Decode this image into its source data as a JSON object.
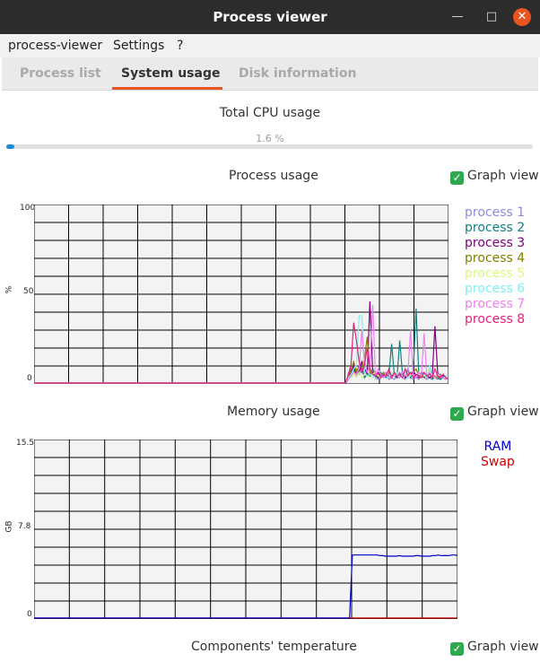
{
  "window": {
    "title": "Process viewer"
  },
  "menu": [
    "process-viewer",
    "Settings",
    "?"
  ],
  "tabs": [
    "Process list",
    "System usage",
    "Disk information"
  ],
  "cpu": {
    "title": "Total CPU usage",
    "percent_text": "1.6 %",
    "percent": 1.6
  },
  "process_usage": {
    "title": "Process usage",
    "graph_view_label": "Graph view",
    "graph_view_checked": true,
    "y_axis": {
      "label": "%",
      "ticks": [
        "100",
        "50",
        "0"
      ],
      "max": 100
    },
    "legend": [
      {
        "name": "process 1",
        "color": "#8c8cdc"
      },
      {
        "name": "process 2",
        "color": "#128080"
      },
      {
        "name": "process 3",
        "color": "#800080"
      },
      {
        "name": "process 4",
        "color": "#808000"
      },
      {
        "name": "process 5",
        "color": "#d8f880"
      },
      {
        "name": "process 6",
        "color": "#80f0f0"
      },
      {
        "name": "process 7",
        "color": "#f080f0"
      },
      {
        "name": "process 8",
        "color": "#e0207e"
      }
    ],
    "series": [
      [
        0,
        0,
        0,
        0,
        0,
        0,
        0,
        0,
        0,
        0,
        0,
        0,
        0,
        0,
        0,
        0,
        0,
        0,
        0,
        0,
        0,
        0,
        0,
        0,
        0,
        0,
        0,
        0,
        0,
        0,
        0,
        0,
        0,
        0,
        0,
        0,
        0,
        0,
        0,
        0,
        0,
        0,
        0,
        0,
        0,
        0,
        0,
        0,
        0,
        0,
        0,
        0,
        0,
        0,
        0,
        0,
        0,
        0,
        0,
        0,
        0,
        0,
        0,
        0,
        0,
        0,
        0,
        0,
        0,
        0,
        0,
        0,
        0,
        0,
        0,
        0,
        0,
        0,
        0,
        0,
        0,
        0,
        0,
        0,
        0,
        0,
        0,
        0,
        0,
        0,
        0,
        0,
        0,
        0,
        0,
        0,
        0,
        0,
        0,
        0,
        0,
        0,
        0,
        0,
        0,
        0,
        0,
        0,
        0,
        0,
        0,
        0,
        0,
        0,
        0,
        0,
        2,
        4,
        6,
        8,
        5,
        7,
        3,
        6,
        4,
        5,
        3,
        2,
        4,
        3,
        5,
        2,
        3,
        2,
        4,
        6,
        3,
        2,
        4,
        3,
        2,
        3,
        2,
        4,
        3,
        2,
        3,
        5,
        3,
        2,
        4,
        3,
        2,
        3
      ],
      [
        0,
        0,
        0,
        0,
        0,
        0,
        0,
        0,
        0,
        0,
        0,
        0,
        0,
        0,
        0,
        0,
        0,
        0,
        0,
        0,
        0,
        0,
        0,
        0,
        0,
        0,
        0,
        0,
        0,
        0,
        0,
        0,
        0,
        0,
        0,
        0,
        0,
        0,
        0,
        0,
        0,
        0,
        0,
        0,
        0,
        0,
        0,
        0,
        0,
        0,
        0,
        0,
        0,
        0,
        0,
        0,
        0,
        0,
        0,
        0,
        0,
        0,
        0,
        0,
        0,
        0,
        0,
        0,
        0,
        0,
        0,
        0,
        0,
        0,
        0,
        0,
        0,
        0,
        0,
        0,
        0,
        0,
        0,
        0,
        0,
        0,
        0,
        0,
        0,
        0,
        0,
        0,
        0,
        0,
        0,
        0,
        0,
        0,
        0,
        0,
        0,
        0,
        0,
        0,
        0,
        0,
        0,
        0,
        0,
        0,
        0,
        0,
        0,
        0,
        0,
        0,
        2,
        5,
        8,
        4,
        6,
        10,
        3,
        5,
        4,
        8,
        5,
        3,
        6,
        4,
        3,
        5,
        22,
        4,
        3,
        24,
        5,
        4,
        8,
        3,
        6,
        42,
        6,
        4,
        3,
        5,
        3,
        2,
        4,
        3,
        2,
        3,
        4,
        2
      ],
      [
        0,
        0,
        0,
        0,
        0,
        0,
        0,
        0,
        0,
        0,
        0,
        0,
        0,
        0,
        0,
        0,
        0,
        0,
        0,
        0,
        0,
        0,
        0,
        0,
        0,
        0,
        0,
        0,
        0,
        0,
        0,
        0,
        0,
        0,
        0,
        0,
        0,
        0,
        0,
        0,
        0,
        0,
        0,
        0,
        0,
        0,
        0,
        0,
        0,
        0,
        0,
        0,
        0,
        0,
        0,
        0,
        0,
        0,
        0,
        0,
        0,
        0,
        0,
        0,
        0,
        0,
        0,
        0,
        0,
        0,
        0,
        0,
        0,
        0,
        0,
        0,
        0,
        0,
        0,
        0,
        0,
        0,
        0,
        0,
        0,
        0,
        0,
        0,
        0,
        0,
        0,
        0,
        0,
        0,
        0,
        0,
        0,
        0,
        0,
        0,
        0,
        0,
        0,
        0,
        0,
        0,
        0,
        0,
        0,
        0,
        0,
        0,
        0,
        0,
        0,
        0,
        3,
        6,
        10,
        4,
        7,
        12,
        8,
        5,
        46,
        6,
        4,
        3,
        5,
        4,
        6,
        3,
        4,
        5,
        3,
        4,
        6,
        3,
        5,
        4,
        7,
        4,
        3,
        6,
        5,
        4,
        3,
        4,
        32,
        6,
        3,
        4,
        3,
        2
      ],
      [
        0,
        0,
        0,
        0,
        0,
        0,
        0,
        0,
        0,
        0,
        0,
        0,
        0,
        0,
        0,
        0,
        0,
        0,
        0,
        0,
        0,
        0,
        0,
        0,
        0,
        0,
        0,
        0,
        0,
        0,
        0,
        0,
        0,
        0,
        0,
        0,
        0,
        0,
        0,
        0,
        0,
        0,
        0,
        0,
        0,
        0,
        0,
        0,
        0,
        0,
        0,
        0,
        0,
        0,
        0,
        0,
        0,
        0,
        0,
        0,
        0,
        0,
        0,
        0,
        0,
        0,
        0,
        0,
        0,
        0,
        0,
        0,
        0,
        0,
        0,
        0,
        0,
        0,
        0,
        0,
        0,
        0,
        0,
        0,
        0,
        0,
        0,
        0,
        0,
        0,
        0,
        0,
        0,
        0,
        0,
        0,
        0,
        0,
        0,
        0,
        0,
        0,
        0,
        0,
        0,
        0,
        0,
        0,
        0,
        0,
        0,
        0,
        0,
        0,
        0,
        0,
        4,
        8,
        12,
        6,
        10,
        8,
        14,
        26,
        5,
        7,
        4,
        5,
        3,
        6,
        4,
        3,
        5,
        4,
        6,
        3,
        4,
        5,
        3,
        4,
        6,
        8,
        4,
        5,
        3,
        4,
        6,
        3,
        4,
        3,
        5,
        3,
        2,
        4
      ],
      [
        0,
        0,
        0,
        0,
        0,
        0,
        0,
        0,
        0,
        0,
        0,
        0,
        0,
        0,
        0,
        0,
        0,
        0,
        0,
        0,
        0,
        0,
        0,
        0,
        0,
        0,
        0,
        0,
        0,
        0,
        0,
        0,
        0,
        0,
        0,
        0,
        0,
        0,
        0,
        0,
        0,
        0,
        0,
        0,
        0,
        0,
        0,
        0,
        0,
        0,
        0,
        0,
        0,
        0,
        0,
        0,
        0,
        0,
        0,
        0,
        0,
        0,
        0,
        0,
        0,
        0,
        0,
        0,
        0,
        0,
        0,
        0,
        0,
        0,
        0,
        0,
        0,
        0,
        0,
        0,
        0,
        0,
        0,
        0,
        0,
        0,
        0,
        0,
        0,
        0,
        0,
        0,
        0,
        0,
        0,
        0,
        0,
        0,
        0,
        0,
        0,
        0,
        0,
        0,
        0,
        0,
        0,
        0,
        0,
        0,
        0,
        0,
        0,
        0,
        0,
        0,
        2,
        3,
        5,
        4,
        6,
        3,
        5,
        4,
        3,
        5,
        6,
        4,
        3,
        5,
        4,
        3,
        6,
        4,
        5,
        3,
        4,
        6,
        3,
        5,
        4,
        3,
        6,
        4,
        5,
        3,
        8,
        4,
        3,
        5,
        4,
        3,
        2,
        3
      ],
      [
        0,
        0,
        0,
        0,
        0,
        0,
        0,
        0,
        0,
        0,
        0,
        0,
        0,
        0,
        0,
        0,
        0,
        0,
        0,
        0,
        0,
        0,
        0,
        0,
        0,
        0,
        0,
        0,
        0,
        0,
        0,
        0,
        0,
        0,
        0,
        0,
        0,
        0,
        0,
        0,
        0,
        0,
        0,
        0,
        0,
        0,
        0,
        0,
        0,
        0,
        0,
        0,
        0,
        0,
        0,
        0,
        0,
        0,
        0,
        0,
        0,
        0,
        0,
        0,
        0,
        0,
        0,
        0,
        0,
        0,
        0,
        0,
        0,
        0,
        0,
        0,
        0,
        0,
        0,
        0,
        0,
        0,
        0,
        0,
        0,
        0,
        0,
        0,
        0,
        0,
        0,
        0,
        0,
        0,
        0,
        0,
        0,
        0,
        0,
        0,
        0,
        0,
        0,
        0,
        0,
        0,
        0,
        0,
        0,
        0,
        0,
        0,
        0,
        0,
        0,
        0,
        3,
        5,
        8,
        10,
        38,
        38,
        6,
        4,
        5,
        3,
        4,
        6,
        3,
        5,
        4,
        3,
        5,
        4,
        6,
        3,
        4,
        5,
        3,
        4,
        5,
        3,
        6,
        4,
        5,
        3,
        10,
        4,
        3,
        5,
        4,
        3,
        4,
        2
      ],
      [
        0,
        0,
        0,
        0,
        0,
        0,
        0,
        0,
        0,
        0,
        0,
        0,
        0,
        0,
        0,
        0,
        0,
        0,
        0,
        0,
        0,
        0,
        0,
        0,
        0,
        0,
        0,
        0,
        0,
        0,
        0,
        0,
        0,
        0,
        0,
        0,
        0,
        0,
        0,
        0,
        0,
        0,
        0,
        0,
        0,
        0,
        0,
        0,
        0,
        0,
        0,
        0,
        0,
        0,
        0,
        0,
        0,
        0,
        0,
        0,
        0,
        0,
        0,
        0,
        0,
        0,
        0,
        0,
        0,
        0,
        0,
        0,
        0,
        0,
        0,
        0,
        0,
        0,
        0,
        0,
        0,
        0,
        0,
        0,
        0,
        0,
        0,
        0,
        0,
        0,
        0,
        0,
        0,
        0,
        0,
        0,
        0,
        0,
        0,
        0,
        0,
        0,
        0,
        0,
        0,
        0,
        0,
        0,
        0,
        0,
        0,
        0,
        0,
        0,
        0,
        0,
        2,
        4,
        6,
        5,
        8,
        30,
        12,
        6,
        10,
        44,
        4,
        8,
        5,
        3,
        6,
        4,
        3,
        5,
        4,
        3,
        6,
        4,
        5,
        30,
        4,
        3,
        6,
        4,
        28,
        3,
        6,
        4,
        3,
        5,
        4,
        3,
        2,
        3
      ],
      [
        0,
        0,
        0,
        0,
        0,
        0,
        0,
        0,
        0,
        0,
        0,
        0,
        0,
        0,
        0,
        0,
        0,
        0,
        0,
        0,
        0,
        0,
        0,
        0,
        0,
        0,
        0,
        0,
        0,
        0,
        0,
        0,
        0,
        0,
        0,
        0,
        0,
        0,
        0,
        0,
        0,
        0,
        0,
        0,
        0,
        0,
        0,
        0,
        0,
        0,
        0,
        0,
        0,
        0,
        0,
        0,
        0,
        0,
        0,
        0,
        0,
        0,
        0,
        0,
        0,
        0,
        0,
        0,
        0,
        0,
        0,
        0,
        0,
        0,
        0,
        0,
        0,
        0,
        0,
        0,
        0,
        0,
        0,
        0,
        0,
        0,
        0,
        0,
        0,
        0,
        0,
        0,
        0,
        0,
        0,
        0,
        0,
        0,
        0,
        0,
        0,
        0,
        0,
        0,
        0,
        0,
        0,
        0,
        0,
        0,
        0,
        0,
        0,
        0,
        0,
        0,
        5,
        10,
        34,
        24,
        12,
        6,
        10,
        20,
        8,
        5,
        4,
        6,
        3,
        5,
        4,
        8,
        3,
        6,
        4,
        5,
        3,
        8,
        4,
        6,
        3,
        5,
        4,
        3,
        6,
        4,
        5,
        3,
        8,
        4,
        3,
        5,
        3,
        2
      ]
    ]
  },
  "memory_usage": {
    "title": "Memory usage",
    "graph_view_label": "Graph view",
    "graph_view_checked": true,
    "y_axis": {
      "label": "GB",
      "ticks": [
        "15.5",
        "7.8",
        "0"
      ],
      "max": 15.5
    },
    "legend": [
      {
        "name": "RAM",
        "color": "#0000d0"
      },
      {
        "name": "Swap",
        "color": "#d00000"
      }
    ],
    "ram": [
      0,
      0,
      0,
      0,
      0,
      0,
      0,
      0,
      0,
      0,
      0,
      0,
      0,
      0,
      0,
      0,
      0,
      0,
      0,
      0,
      0,
      0,
      0,
      0,
      0,
      0,
      0,
      0,
      0,
      0,
      0,
      0,
      0,
      0,
      0,
      0,
      0,
      0,
      0,
      0,
      0,
      0,
      0,
      0,
      0,
      0,
      0,
      0,
      0,
      0,
      0,
      0,
      0,
      0,
      0,
      0,
      0,
      0,
      0,
      0,
      0,
      0,
      0,
      0,
      0,
      0,
      0,
      0,
      0,
      0,
      0,
      0,
      0,
      0,
      0,
      0,
      0,
      0,
      0,
      0,
      0,
      0,
      0,
      0,
      0,
      0,
      0,
      0,
      0,
      0,
      0,
      0,
      0,
      0,
      0,
      0,
      0,
      0,
      0,
      0,
      0,
      0,
      0,
      0,
      0,
      0,
      0,
      0,
      0,
      0,
      0,
      0,
      0,
      0,
      0,
      5.5,
      5.5,
      5.5,
      5.5,
      5.5,
      5.5,
      5.5,
      5.5,
      5.5,
      5.5,
      5.45,
      5.45,
      5.4,
      5.4,
      5.4,
      5.4,
      5.4,
      5.45,
      5.4,
      5.4,
      5.4,
      5.4,
      5.4,
      5.45,
      5.45,
      5.4,
      5.4,
      5.4,
      5.4,
      5.45,
      5.45,
      5.5,
      5.45,
      5.45,
      5.45,
      5.45,
      5.5,
      5.5,
      5.45
    ],
    "swap": [
      0
    ]
  },
  "temperature": {
    "title": "Components' temperature",
    "graph_view_label": "Graph view"
  }
}
